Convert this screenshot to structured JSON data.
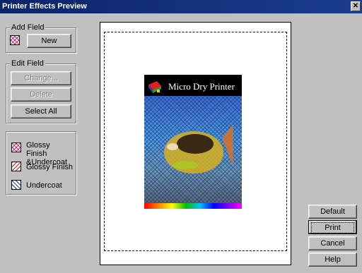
{
  "window": {
    "title": "Printer Effects Preview",
    "close_label": "✕"
  },
  "add_field": {
    "label": "Add Field",
    "new_button": "New"
  },
  "edit_field": {
    "label": "Edit Field",
    "change_button": "Change...",
    "delete_button": "Delete",
    "select_all_button": "Select All"
  },
  "legend": {
    "items": [
      {
        "label": "Glossy Finish &Undercoat",
        "pattern": "crosshatch-magenta"
      },
      {
        "label": "Glossy Finish",
        "pattern": "diagonal-red"
      },
      {
        "label": "Undercoat",
        "pattern": "diagonal-blue"
      }
    ]
  },
  "preview": {
    "image_title": "Micro Dry Printer"
  },
  "buttons": {
    "default": "Default",
    "print": "Print",
    "cancel": "Cancel",
    "help": "Help"
  },
  "colors": {
    "title_bar": "#0a246a",
    "dialog_bg": "#c0c0c0"
  }
}
